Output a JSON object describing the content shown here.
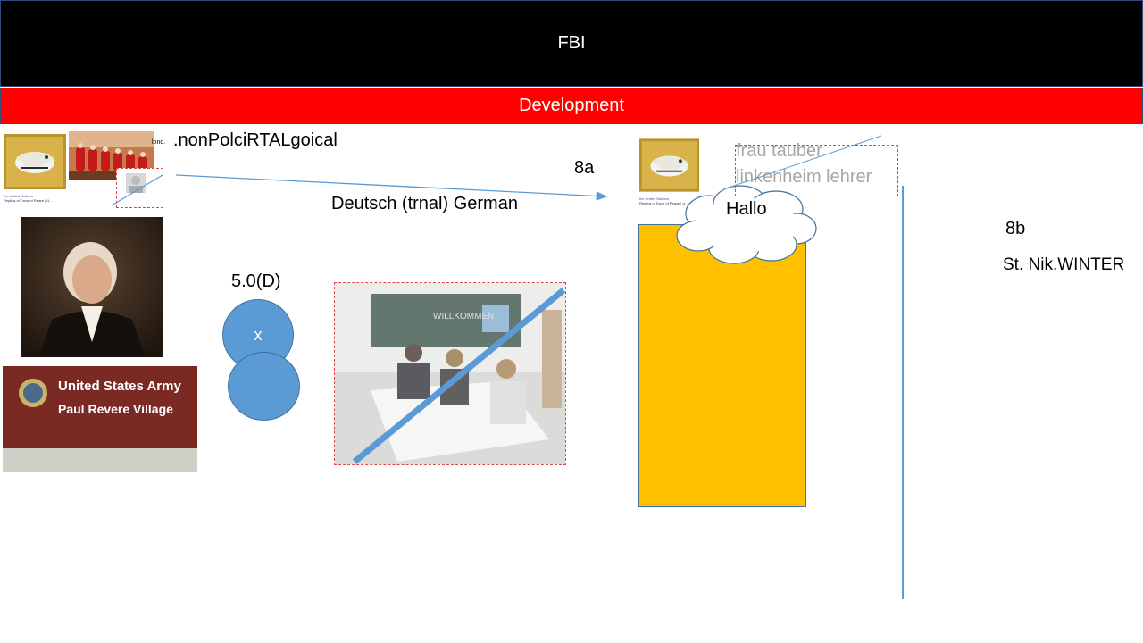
{
  "header": {
    "title": "FBI"
  },
  "banner": {
    "label": "Development"
  },
  "labels": {
    "non_political": ".nonPolciRTALgoical",
    "tiny_prefix": "lond.",
    "label_8a": "8a",
    "deutsch": "Deutsch (trnal) German",
    "label_8b": "8b",
    "st_nik": "St. Nik.WINTER",
    "grade": "5.0(D)",
    "circle_mark": "x",
    "hallo": "Hallo",
    "teacher_line1": "frau tauber",
    "teacher_line2": "linkenheim lehrer",
    "army_line1": "United States Army",
    "army_line2": "Paul Revere Village",
    "dove_caption1": "the United Nations",
    "dove_caption2": "Replica of Dove of Peace | U...",
    "classroom_board": "WILLKOMMEN"
  },
  "colors": {
    "accent_red": "#ff0000",
    "circle_blue": "#5b9bd5",
    "box_yellow": "#ffc000",
    "arrow_blue": "#5b9bd5"
  }
}
